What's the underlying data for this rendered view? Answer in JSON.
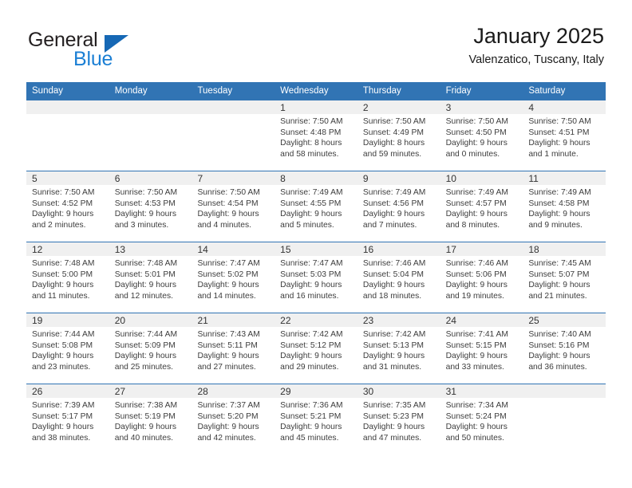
{
  "brand": {
    "name_top": "General",
    "name_bottom": "Blue",
    "triangle_color": "#1668b5",
    "blue_text_color": "#1b7fd4"
  },
  "header": {
    "title": "January 2025",
    "subtitle": "Valenzatico, Tuscany, Italy"
  },
  "theme": {
    "header_bar_color": "#3174b4",
    "day_band_color": "#f0f0f0",
    "row_divider_color": "#3174b4"
  },
  "weekday_headers": [
    "Sunday",
    "Monday",
    "Tuesday",
    "Wednesday",
    "Thursday",
    "Friday",
    "Saturday"
  ],
  "weeks": [
    [
      {
        "day": "",
        "sunrise": "",
        "sunset": "",
        "daylight_line1": "",
        "daylight_line2": ""
      },
      {
        "day": "",
        "sunrise": "",
        "sunset": "",
        "daylight_line1": "",
        "daylight_line2": ""
      },
      {
        "day": "",
        "sunrise": "",
        "sunset": "",
        "daylight_line1": "",
        "daylight_line2": ""
      },
      {
        "day": "1",
        "sunrise": "Sunrise: 7:50 AM",
        "sunset": "Sunset: 4:48 PM",
        "daylight_line1": "Daylight: 8 hours",
        "daylight_line2": "and 58 minutes."
      },
      {
        "day": "2",
        "sunrise": "Sunrise: 7:50 AM",
        "sunset": "Sunset: 4:49 PM",
        "daylight_line1": "Daylight: 8 hours",
        "daylight_line2": "and 59 minutes."
      },
      {
        "day": "3",
        "sunrise": "Sunrise: 7:50 AM",
        "sunset": "Sunset: 4:50 PM",
        "daylight_line1": "Daylight: 9 hours",
        "daylight_line2": "and 0 minutes."
      },
      {
        "day": "4",
        "sunrise": "Sunrise: 7:50 AM",
        "sunset": "Sunset: 4:51 PM",
        "daylight_line1": "Daylight: 9 hours",
        "daylight_line2": "and 1 minute."
      }
    ],
    [
      {
        "day": "5",
        "sunrise": "Sunrise: 7:50 AM",
        "sunset": "Sunset: 4:52 PM",
        "daylight_line1": "Daylight: 9 hours",
        "daylight_line2": "and 2 minutes."
      },
      {
        "day": "6",
        "sunrise": "Sunrise: 7:50 AM",
        "sunset": "Sunset: 4:53 PM",
        "daylight_line1": "Daylight: 9 hours",
        "daylight_line2": "and 3 minutes."
      },
      {
        "day": "7",
        "sunrise": "Sunrise: 7:50 AM",
        "sunset": "Sunset: 4:54 PM",
        "daylight_line1": "Daylight: 9 hours",
        "daylight_line2": "and 4 minutes."
      },
      {
        "day": "8",
        "sunrise": "Sunrise: 7:49 AM",
        "sunset": "Sunset: 4:55 PM",
        "daylight_line1": "Daylight: 9 hours",
        "daylight_line2": "and 5 minutes."
      },
      {
        "day": "9",
        "sunrise": "Sunrise: 7:49 AM",
        "sunset": "Sunset: 4:56 PM",
        "daylight_line1": "Daylight: 9 hours",
        "daylight_line2": "and 7 minutes."
      },
      {
        "day": "10",
        "sunrise": "Sunrise: 7:49 AM",
        "sunset": "Sunset: 4:57 PM",
        "daylight_line1": "Daylight: 9 hours",
        "daylight_line2": "and 8 minutes."
      },
      {
        "day": "11",
        "sunrise": "Sunrise: 7:49 AM",
        "sunset": "Sunset: 4:58 PM",
        "daylight_line1": "Daylight: 9 hours",
        "daylight_line2": "and 9 minutes."
      }
    ],
    [
      {
        "day": "12",
        "sunrise": "Sunrise: 7:48 AM",
        "sunset": "Sunset: 5:00 PM",
        "daylight_line1": "Daylight: 9 hours",
        "daylight_line2": "and 11 minutes."
      },
      {
        "day": "13",
        "sunrise": "Sunrise: 7:48 AM",
        "sunset": "Sunset: 5:01 PM",
        "daylight_line1": "Daylight: 9 hours",
        "daylight_line2": "and 12 minutes."
      },
      {
        "day": "14",
        "sunrise": "Sunrise: 7:47 AM",
        "sunset": "Sunset: 5:02 PM",
        "daylight_line1": "Daylight: 9 hours",
        "daylight_line2": "and 14 minutes."
      },
      {
        "day": "15",
        "sunrise": "Sunrise: 7:47 AM",
        "sunset": "Sunset: 5:03 PM",
        "daylight_line1": "Daylight: 9 hours",
        "daylight_line2": "and 16 minutes."
      },
      {
        "day": "16",
        "sunrise": "Sunrise: 7:46 AM",
        "sunset": "Sunset: 5:04 PM",
        "daylight_line1": "Daylight: 9 hours",
        "daylight_line2": "and 18 minutes."
      },
      {
        "day": "17",
        "sunrise": "Sunrise: 7:46 AM",
        "sunset": "Sunset: 5:06 PM",
        "daylight_line1": "Daylight: 9 hours",
        "daylight_line2": "and 19 minutes."
      },
      {
        "day": "18",
        "sunrise": "Sunrise: 7:45 AM",
        "sunset": "Sunset: 5:07 PM",
        "daylight_line1": "Daylight: 9 hours",
        "daylight_line2": "and 21 minutes."
      }
    ],
    [
      {
        "day": "19",
        "sunrise": "Sunrise: 7:44 AM",
        "sunset": "Sunset: 5:08 PM",
        "daylight_line1": "Daylight: 9 hours",
        "daylight_line2": "and 23 minutes."
      },
      {
        "day": "20",
        "sunrise": "Sunrise: 7:44 AM",
        "sunset": "Sunset: 5:09 PM",
        "daylight_line1": "Daylight: 9 hours",
        "daylight_line2": "and 25 minutes."
      },
      {
        "day": "21",
        "sunrise": "Sunrise: 7:43 AM",
        "sunset": "Sunset: 5:11 PM",
        "daylight_line1": "Daylight: 9 hours",
        "daylight_line2": "and 27 minutes."
      },
      {
        "day": "22",
        "sunrise": "Sunrise: 7:42 AM",
        "sunset": "Sunset: 5:12 PM",
        "daylight_line1": "Daylight: 9 hours",
        "daylight_line2": "and 29 minutes."
      },
      {
        "day": "23",
        "sunrise": "Sunrise: 7:42 AM",
        "sunset": "Sunset: 5:13 PM",
        "daylight_line1": "Daylight: 9 hours",
        "daylight_line2": "and 31 minutes."
      },
      {
        "day": "24",
        "sunrise": "Sunrise: 7:41 AM",
        "sunset": "Sunset: 5:15 PM",
        "daylight_line1": "Daylight: 9 hours",
        "daylight_line2": "and 33 minutes."
      },
      {
        "day": "25",
        "sunrise": "Sunrise: 7:40 AM",
        "sunset": "Sunset: 5:16 PM",
        "daylight_line1": "Daylight: 9 hours",
        "daylight_line2": "and 36 minutes."
      }
    ],
    [
      {
        "day": "26",
        "sunrise": "Sunrise: 7:39 AM",
        "sunset": "Sunset: 5:17 PM",
        "daylight_line1": "Daylight: 9 hours",
        "daylight_line2": "and 38 minutes."
      },
      {
        "day": "27",
        "sunrise": "Sunrise: 7:38 AM",
        "sunset": "Sunset: 5:19 PM",
        "daylight_line1": "Daylight: 9 hours",
        "daylight_line2": "and 40 minutes."
      },
      {
        "day": "28",
        "sunrise": "Sunrise: 7:37 AM",
        "sunset": "Sunset: 5:20 PM",
        "daylight_line1": "Daylight: 9 hours",
        "daylight_line2": "and 42 minutes."
      },
      {
        "day": "29",
        "sunrise": "Sunrise: 7:36 AM",
        "sunset": "Sunset: 5:21 PM",
        "daylight_line1": "Daylight: 9 hours",
        "daylight_line2": "and 45 minutes."
      },
      {
        "day": "30",
        "sunrise": "Sunrise: 7:35 AM",
        "sunset": "Sunset: 5:23 PM",
        "daylight_line1": "Daylight: 9 hours",
        "daylight_line2": "and 47 minutes."
      },
      {
        "day": "31",
        "sunrise": "Sunrise: 7:34 AM",
        "sunset": "Sunset: 5:24 PM",
        "daylight_line1": "Daylight: 9 hours",
        "daylight_line2": "and 50 minutes."
      },
      {
        "day": "",
        "sunrise": "",
        "sunset": "",
        "daylight_line1": "",
        "daylight_line2": ""
      }
    ]
  ]
}
